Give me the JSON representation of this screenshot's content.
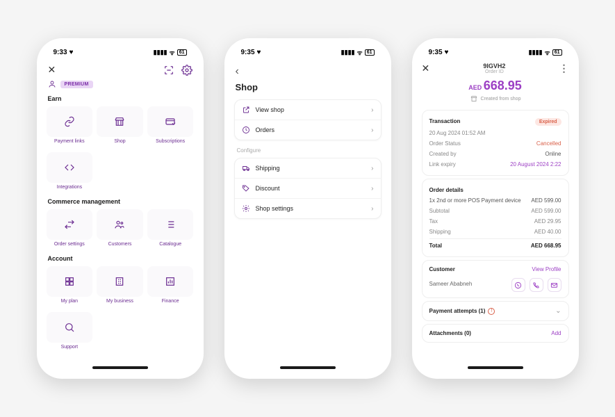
{
  "phone1": {
    "time": "9:33",
    "premium": "PREMIUM",
    "sections": {
      "earn": "Earn",
      "commerce": "Commerce management",
      "account": "Account"
    },
    "tiles": {
      "payment_links": "Payment links",
      "shop": "Shop",
      "subscriptions": "Subscriptions",
      "integrations": "Integrations",
      "order_settings": "Order settings",
      "customers": "Customers",
      "catalogue": "Catalogue",
      "my_plan": "My plan",
      "my_business": "My business",
      "finance": "Finance",
      "support": "Support"
    }
  },
  "phone2": {
    "time": "9:35",
    "title": "Shop",
    "configure": "Configure",
    "rows": {
      "view_shop": "View shop",
      "orders": "Orders",
      "shipping": "Shipping",
      "discount": "Discount",
      "shop_settings": "Shop settings"
    }
  },
  "phone3": {
    "time": "9:35",
    "order_id": "9IGVH2",
    "order_id_sub": "Order ID",
    "currency": "AED",
    "amount": "668.95",
    "created_from": "Created from shop",
    "transaction": {
      "label": "Transaction",
      "expired": "Expired",
      "datetime": "20 Aug 2024 01:52 AM",
      "status_label": "Order Status",
      "status_value": "Cancelled",
      "created_by_label": "Created by",
      "created_by_value": "Online",
      "link_expiry_label": "Link expiry",
      "link_expiry_value": "20 August 2024 2:22"
    },
    "details": {
      "label": "Order details",
      "line_item": "1x 2nd or more POS Payment device",
      "line_item_price": "AED 599.00",
      "subtotal_label": "Subtotal",
      "subtotal_value": "AED 599.00",
      "tax_label": "Tax",
      "tax_value": "AED 29.95",
      "shipping_label": "Shipping",
      "shipping_value": "AED 40.00",
      "total_label": "Total",
      "total_value": "AED 668.95"
    },
    "customer": {
      "label": "Customer",
      "view_profile": "View Profile",
      "name": "Sameer Ababneh"
    },
    "payment_attempts": "Payment attempts (1)",
    "attachments": "Attachments (0)",
    "add": "Add"
  }
}
